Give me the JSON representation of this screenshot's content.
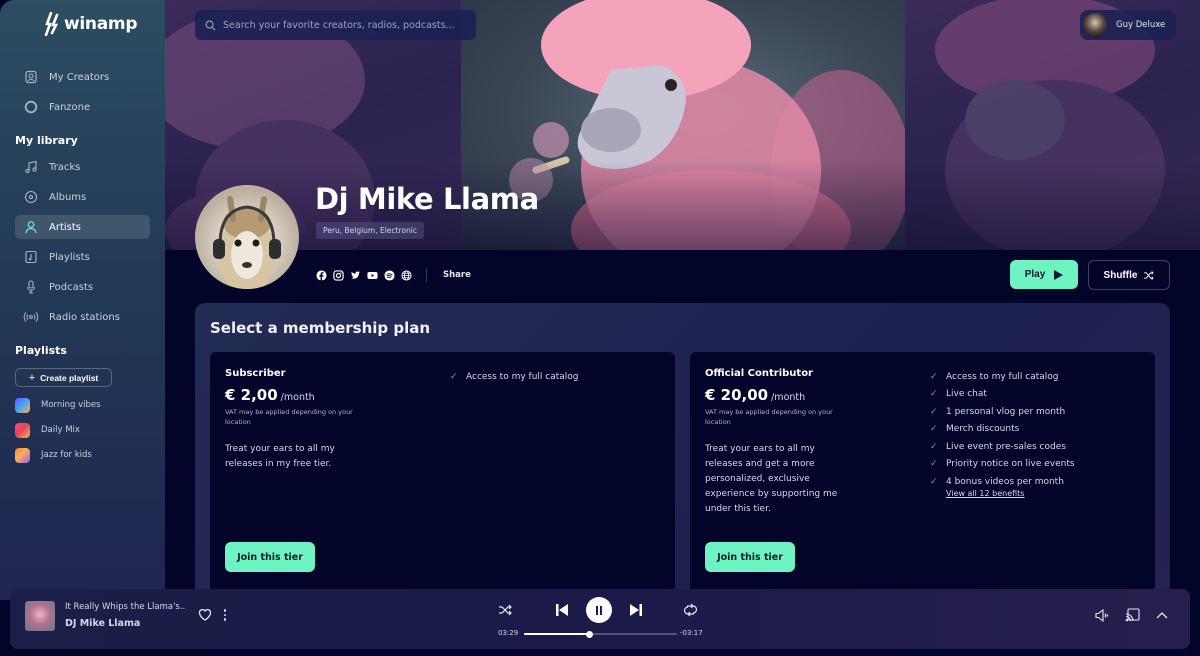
{
  "app": {
    "name": "winamp"
  },
  "sidebar": {
    "items": [
      {
        "label": "My Creators",
        "icon": "creators-icon"
      },
      {
        "label": "Fanzone",
        "icon": "fanzone-icon"
      }
    ],
    "library_title": "My library",
    "library_items": [
      {
        "label": "Tracks",
        "icon": "music-note-icon"
      },
      {
        "label": "Albums",
        "icon": "disc-icon"
      },
      {
        "label": "Artists",
        "icon": "user-icon",
        "active": true
      },
      {
        "label": "Playlists",
        "icon": "playlist-icon"
      },
      {
        "label": "Podcasts",
        "icon": "microphone-icon"
      },
      {
        "label": "Radio stations",
        "icon": "radio-icon"
      }
    ],
    "playlists_title": "Playlists",
    "create_playlist_label": "Create playlist",
    "playlists": [
      {
        "label": "Morning vibes"
      },
      {
        "label": "Daily Mix"
      },
      {
        "label": "Jazz for kids"
      }
    ]
  },
  "header": {
    "search_placeholder": "Search your favorite creators, radios, podcasts...",
    "user_name": "Guy Deluxe"
  },
  "artist": {
    "name": "Dj Mike Llama",
    "tags": "Peru, Belgium, Electronic",
    "socials": [
      "facebook-icon",
      "instagram-icon",
      "twitter-icon",
      "youtube-icon",
      "spotify-icon",
      "globe-icon"
    ],
    "share_label": "Share",
    "play_label": "Play",
    "shuffle_label": "Shuffle"
  },
  "membership": {
    "title": "Select a membership plan",
    "tiers": [
      {
        "name": "Subscriber",
        "price": "€ 2,00",
        "period": "/month",
        "vat_note": "VAT may be applied depending on your location",
        "description": "Treat your ears to all my releases in my free tier.",
        "benefits": [
          "Access to my full catalog"
        ],
        "join_label": "Join this tier"
      },
      {
        "name": "Official Contributor",
        "price": "€ 20,00",
        "period": "/month",
        "vat_note": "VAT may be applied depending on your location",
        "description": "Treat your ears to all my releases and get a more personalized, exclusive experience by supporting me under this tier.",
        "benefits": [
          "Access to my full catalog",
          "Live chat",
          "1 personal vlog per month",
          "Merch discounts",
          "Live event pre-sales codes",
          "Priority notice on live events",
          "4 bonus videos per month"
        ],
        "view_all_label": "View all 12 benefits",
        "join_label": "Join this tier"
      }
    ]
  },
  "player": {
    "track_title": "It Really Whips the Llama's...",
    "track_artist": "DJ Mike Llama",
    "elapsed": "03:29",
    "remaining": "-03:17",
    "progress": 0.43,
    "state": "playing"
  },
  "colors": {
    "accent": "#6ff3c2",
    "background": "#03042a"
  }
}
